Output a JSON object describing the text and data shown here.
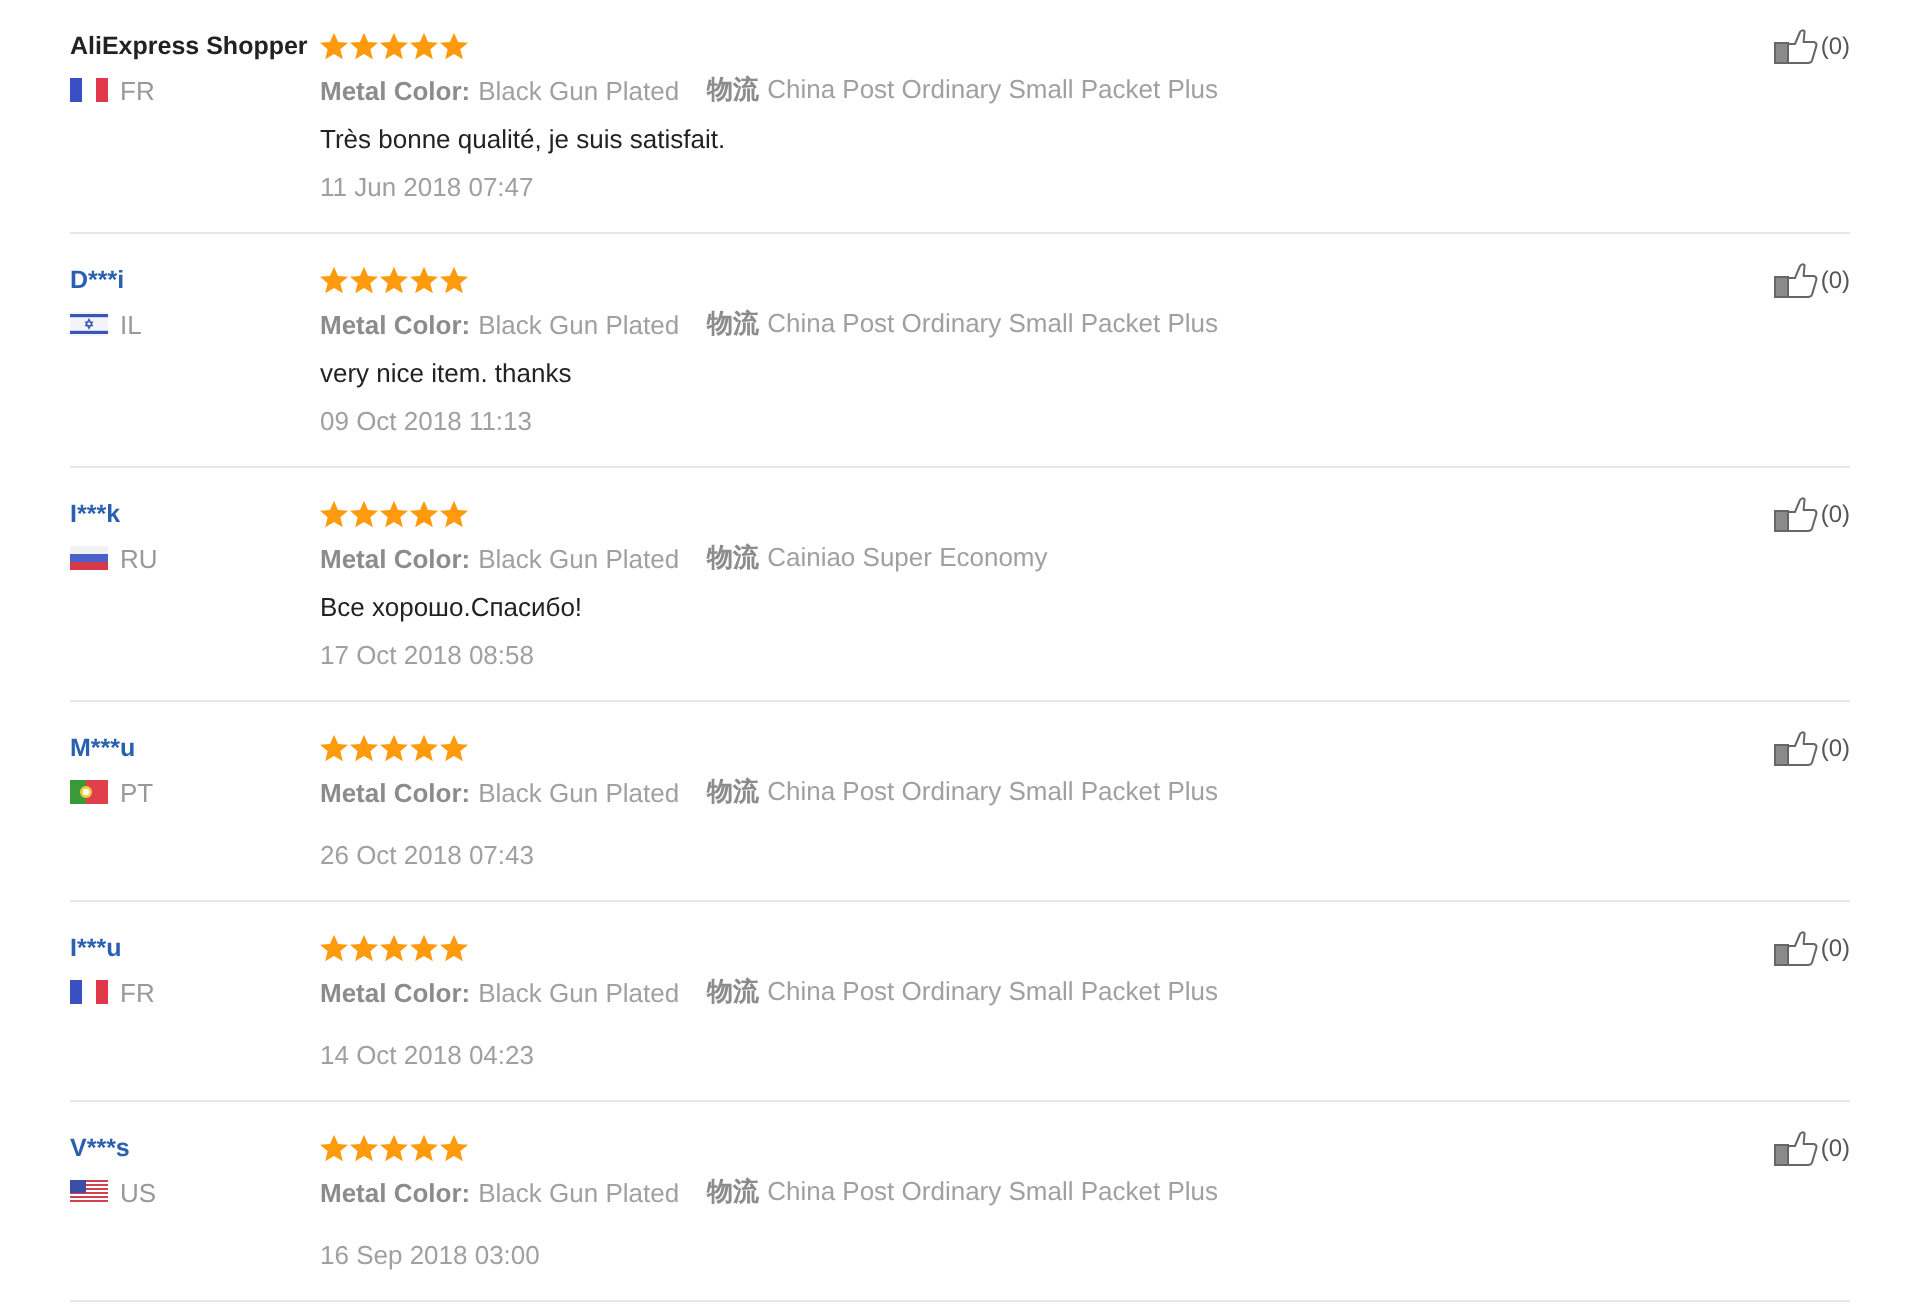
{
  "reviews": [
    {
      "name": "AliExpress Shopper",
      "linked": false,
      "flag": {
        "kind": "france"
      },
      "country": "FR",
      "stars": 5,
      "attributes": [
        {
          "label": "Metal Color:",
          "value": "Black Gun Plated"
        },
        {
          "label": "物流",
          "value": "China Post Ordinary Small Packet Plus"
        }
      ],
      "text": "Très bonne qualité, je suis satisfait.",
      "date": "11 Jun 2018 07:47",
      "likes": "(0)"
    },
    {
      "name": "D***i",
      "linked": true,
      "flag": {
        "kind": "israel"
      },
      "country": "IL",
      "stars": 5,
      "attributes": [
        {
          "label": "Metal Color:",
          "value": "Black Gun Plated"
        },
        {
          "label": "物流",
          "value": "China Post Ordinary Small Packet Plus"
        }
      ],
      "text": "very nice item. thanks",
      "date": "09 Oct 2018 11:13",
      "likes": "(0)"
    },
    {
      "name": "I***k",
      "linked": true,
      "flag": {
        "kind": "russia"
      },
      "country": "RU",
      "stars": 5,
      "attributes": [
        {
          "label": "Metal Color:",
          "value": "Black Gun Plated"
        },
        {
          "label": "物流",
          "value": "Cainiao Super Economy"
        }
      ],
      "text": "Все хорошо.Спасибо!",
      "date": "17 Oct 2018 08:58",
      "likes": "(0)"
    },
    {
      "name": "M***u",
      "linked": true,
      "flag": {
        "kind": "portugal"
      },
      "country": "PT",
      "stars": 5,
      "attributes": [
        {
          "label": "Metal Color:",
          "value": "Black Gun Plated"
        },
        {
          "label": "物流",
          "value": "China Post Ordinary Small Packet Plus"
        }
      ],
      "date": "26 Oct 2018 07:43",
      "likes": "(0)"
    },
    {
      "name": "I***u",
      "linked": true,
      "flag": {
        "kind": "france"
      },
      "country": "FR",
      "stars": 5,
      "attributes": [
        {
          "label": "Metal Color:",
          "value": "Black Gun Plated"
        },
        {
          "label": "物流",
          "value": "China Post Ordinary Small Packet Plus"
        }
      ],
      "date": "14 Oct 2018 04:23",
      "likes": "(0)"
    },
    {
      "name": "V***s",
      "linked": true,
      "flag": {
        "kind": "usa"
      },
      "country": "US",
      "stars": 5,
      "attributes": [
        {
          "label": "Metal Color:",
          "value": "Black Gun Plated"
        },
        {
          "label": "物流",
          "value": "China Post Ordinary Small Packet Plus"
        }
      ],
      "date": "16 Sep 2018 03:00",
      "likes": "(0)"
    }
  ]
}
